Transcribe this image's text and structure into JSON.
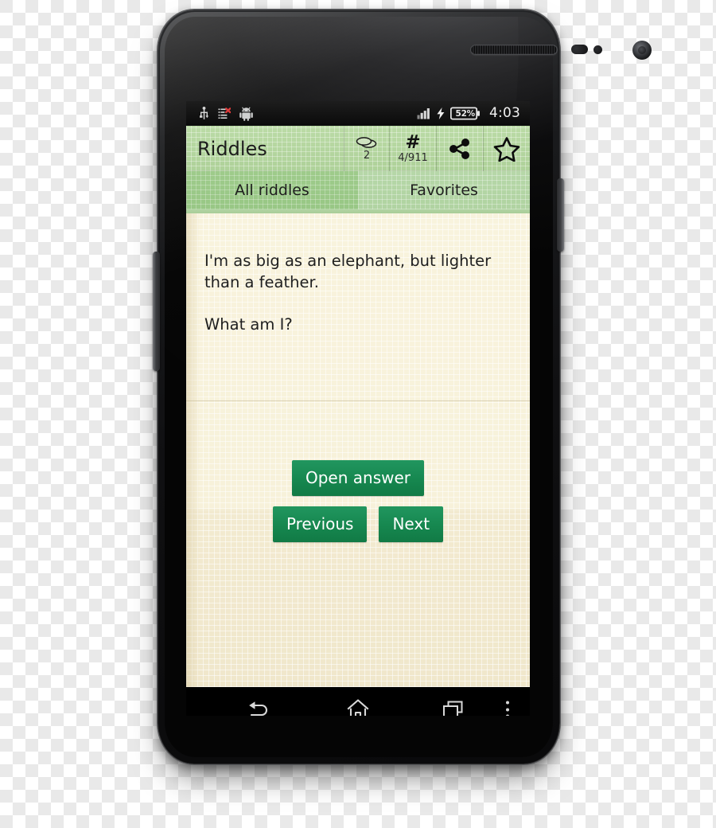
{
  "device": {
    "type": "android-smartphone",
    "hardware": {
      "earpiece": "speaker-grille",
      "front_camera": "front-camera",
      "proximity_sensor": "proximity-sensor",
      "light_sensor": "light-sensor",
      "volume_rocker": "volume-rocker",
      "power_button": "power-button"
    }
  },
  "statusbar": {
    "left_icons": [
      "usb-icon",
      "list-error-icon",
      "android-robot-icon"
    ],
    "signal": "signal-bars-icon",
    "charging": "charging-bolt-icon",
    "battery_text": "52%",
    "time": "4:03"
  },
  "actionbar": {
    "title": "Riddles",
    "items": [
      {
        "name": "coins-counter",
        "icon": "coins-icon",
        "label": "2"
      },
      {
        "name": "riddle-index",
        "icon": "hash-icon",
        "glyph": "#",
        "label": "4/911"
      },
      {
        "name": "share-button",
        "icon": "share-icon",
        "label": ""
      },
      {
        "name": "favorite-button",
        "icon": "star-outline-icon",
        "label": ""
      }
    ]
  },
  "tabs": [
    {
      "label": "All riddles",
      "selected": true
    },
    {
      "label": "Favorites",
      "selected": false
    }
  ],
  "content": {
    "riddle_line1": "I'm as big as an elephant, but lighter than a feather.",
    "riddle_line2": "What am I?"
  },
  "buttons": {
    "open_answer": "Open answer",
    "previous": "Previous",
    "next": "Next"
  },
  "navbar": {
    "back": "back-icon",
    "home": "home-icon",
    "recent": "recent-apps-icon",
    "overflow": "overflow-menu-icon"
  },
  "colors": {
    "accent_green": "#16874f",
    "bar_green": "#b6d7a8",
    "tab_selected_green": "#9ecb8b",
    "paper": "#f7f2dc",
    "status_bar": "#121212"
  }
}
